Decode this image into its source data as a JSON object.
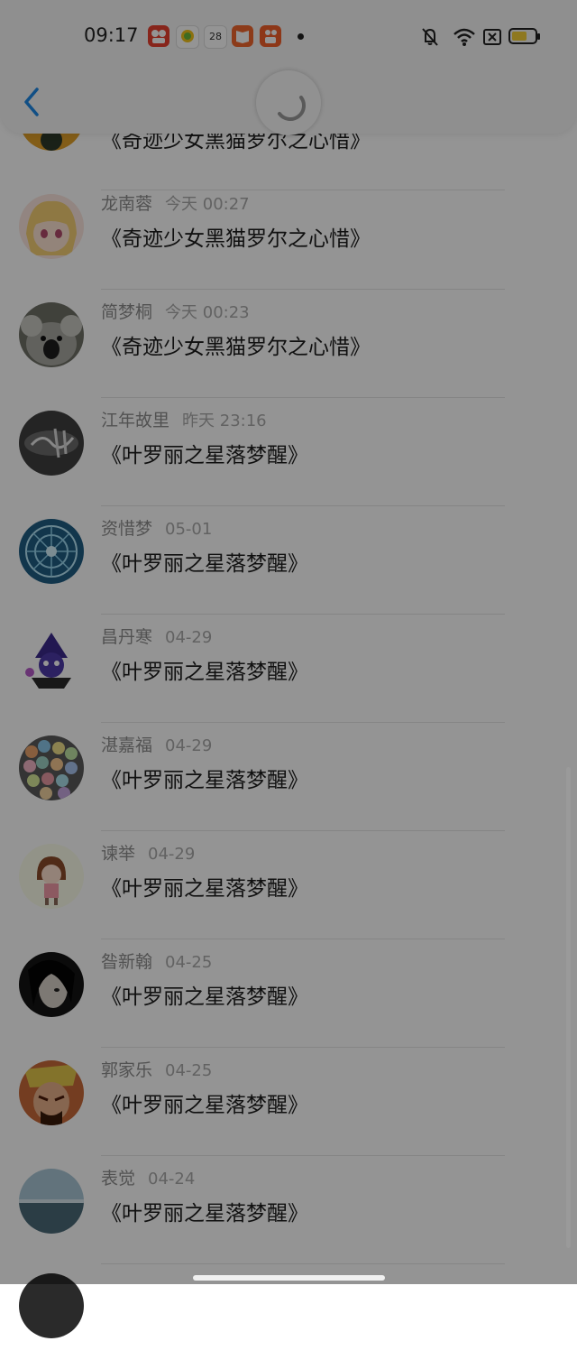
{
  "status_bar": {
    "time": "09:17",
    "calendar_day": "28",
    "icons": [
      "app-icon-1",
      "app-icon-2",
      "calendar-icon",
      "book-app-icon",
      "kuaishou-icon",
      "notification-dot",
      "mute-icon",
      "wifi-icon",
      "sim-off-icon",
      "battery-icon"
    ]
  },
  "header": {
    "back_label": "‹"
  },
  "list": [
    {
      "name": "",
      "time": "",
      "title": "《奇迹少女黑猫罗尔之心惜》",
      "avatar": "avatar-partial"
    },
    {
      "name": "龙南蓉",
      "time": "今天 00:27",
      "title": "《奇迹少女黑猫罗尔之心惜》",
      "avatar": "anime-girl"
    },
    {
      "name": "简梦桐",
      "time": "今天 00:23",
      "title": "《奇迹少女黑猫罗尔之心惜》",
      "avatar": "koala"
    },
    {
      "name": "江年故里",
      "time": "昨天 23:16",
      "title": "《叶罗丽之星落梦醒》",
      "avatar": "calligraphy"
    },
    {
      "name": "资惜梦",
      "time": "05-01",
      "title": "《叶罗丽之星落梦醒》",
      "avatar": "mandala"
    },
    {
      "name": "昌丹寒",
      "time": "04-29",
      "title": "《叶罗丽之星落梦醒》",
      "avatar": "cartoon-mage"
    },
    {
      "name": "湛嘉福",
      "time": "04-29",
      "title": "《叶罗丽之星落梦醒》",
      "avatar": "gumballs"
    },
    {
      "name": "谏举",
      "time": "04-29",
      "title": "《叶罗丽之星落梦醒》",
      "avatar": "cartoon-girl"
    },
    {
      "name": "昝新翰",
      "time": "04-25",
      "title": "《叶罗丽之星落梦醒》",
      "avatar": "dark-portrait"
    },
    {
      "name": "郭家乐",
      "time": "04-25",
      "title": "《叶罗丽之星落梦醒》",
      "avatar": "warrior"
    },
    {
      "name": "表觉",
      "time": "04-24",
      "title": "《叶罗丽之星落梦醒》",
      "avatar": "seascape"
    },
    {
      "name": "",
      "time": "",
      "title": "",
      "avatar": "avatar-partial"
    }
  ]
}
